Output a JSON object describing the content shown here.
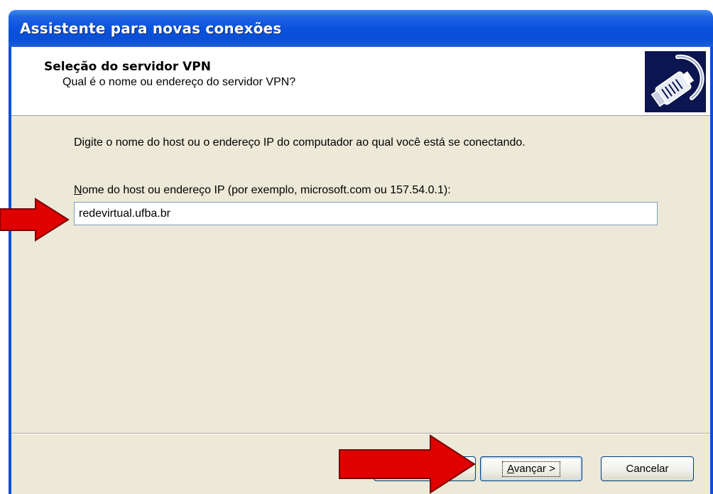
{
  "window": {
    "title": "Assistente para novas conexões"
  },
  "header": {
    "title": "Seleção do servidor VPN",
    "subtitle": "Qual é o nome ou endereço do servidor VPN?",
    "icon": "network-cable-icon"
  },
  "body": {
    "description": "Digite o nome do host ou o endereço IP do computador ao qual você está se conectando.",
    "field_label_mnemonic": "N",
    "field_label_rest": "ome do host ou endereço IP (por exemplo, microsoft.com ou 157.54.0.1):",
    "host_value": "redevirtual.ufba.br"
  },
  "footer": {
    "back_label": "",
    "next_mnemonic": "A",
    "next_rest": "vançar >",
    "cancel_label": "Cancelar"
  },
  "annotations": {
    "arrow_color": "#e00000"
  }
}
